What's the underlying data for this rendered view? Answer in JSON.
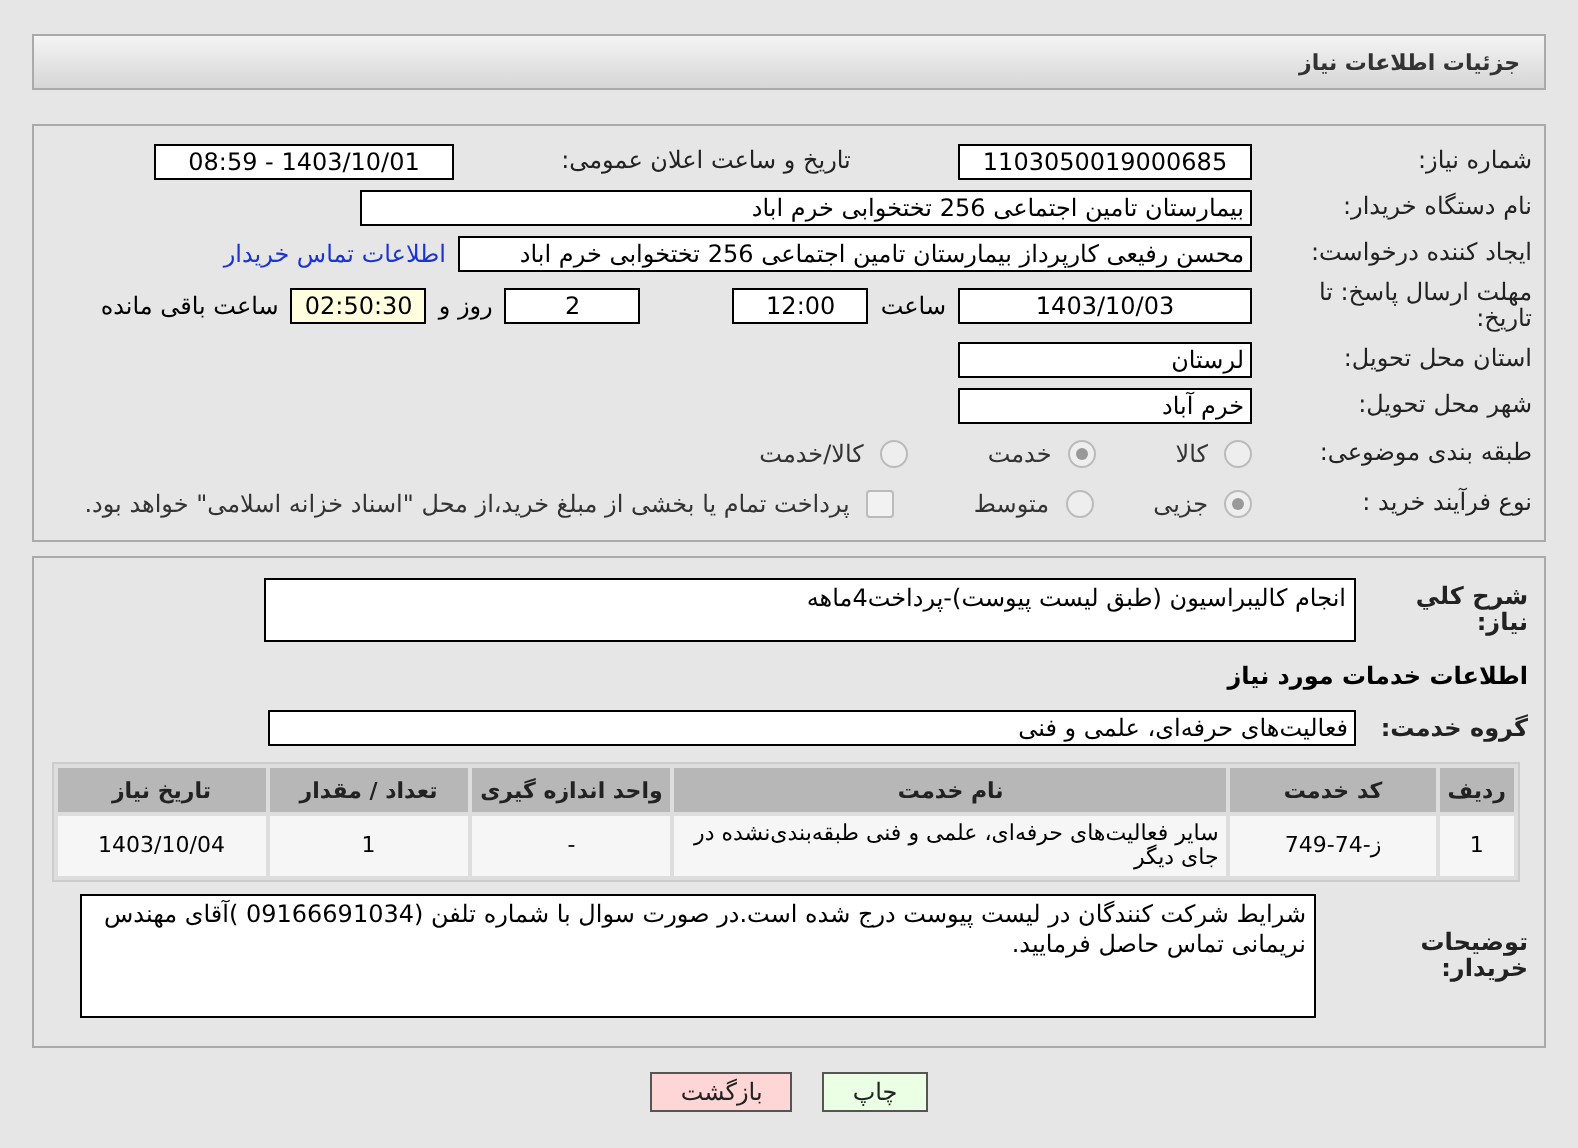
{
  "header": {
    "title": "جزئیات اطلاعات نیاز"
  },
  "need_number": {
    "label": "شماره نیاز:",
    "value": "1103050019000685"
  },
  "announce": {
    "label": "تاریخ و ساعت اعلان عمومی:",
    "value": "1403/10/01 - 08:59"
  },
  "buyer_org": {
    "label": "نام دستگاه خریدار:",
    "value": "بیمارستان تامین اجتماعی  256 تختخوابی خرم اباد"
  },
  "requester": {
    "label": "ایجاد کننده درخواست:",
    "value": "محسن رفیعی کارپرداز بیمارستان تامین اجتماعی  256 تختخوابی خرم اباد",
    "link": "اطلاعات تماس خریدار"
  },
  "deadline": {
    "label": "مهلت ارسال پاسخ: تا تاریخ:",
    "date": "1403/10/03",
    "time_label": "ساعت",
    "time": "12:00",
    "days": "2",
    "days_label": "روز و",
    "remaining": "02:50:30",
    "remaining_label": "ساعت باقی مانده"
  },
  "province": {
    "label": "استان محل تحویل:",
    "value": "لرستان"
  },
  "city": {
    "label": "شهر محل تحویل:",
    "value": "خرم آباد"
  },
  "category": {
    "label": "طبقه بندی موضوعی:",
    "options": [
      {
        "label": "کالا",
        "selected": false
      },
      {
        "label": "خدمت",
        "selected": true
      },
      {
        "label": "کالا/خدمت",
        "selected": false
      }
    ]
  },
  "process": {
    "label": "نوع فرآیند خرید :",
    "options": [
      {
        "label": "جزیی",
        "selected": true
      },
      {
        "label": "متوسط",
        "selected": false
      }
    ],
    "payment": {
      "label": "پرداخت تمام یا بخشی از مبلغ خرید،از محل \"اسناد خزانه اسلامی\" خواهد بود.",
      "checked": false
    }
  },
  "description": {
    "label": "شرح کلي نياز:",
    "value": "انجام کالیبراسیون (طبق لیست پیوست)-پرداخت4ماهه"
  },
  "services_title": "اطلاعات خدمات مورد نیاز",
  "service_group": {
    "label": "گروه خدمت:",
    "value": "فعالیت‌های حرفه‌ای، علمی و فنی"
  },
  "table": {
    "columns": [
      "ردیف",
      "کد خدمت",
      "نام خدمت",
      "واحد اندازه گیری",
      "تعداد / مقدار",
      "تاریخ نیاز"
    ],
    "rows": [
      [
        "1",
        "ز-74-749",
        "سایر فعالیت‌های حرفه‌ای، علمی و فنی طبقه‌بندی‌نشده در جای دیگر",
        "-",
        "1",
        "1403/10/04"
      ]
    ]
  },
  "buyer_notes": {
    "label": "توضیحات خریدار:",
    "value": "شرایط شرکت کنندگان در لیست پیوست درج شده است.در صورت سوال با شماره تلفن (09166691034 )آقای مهندس نریمانی تماس حاصل فرمایید."
  },
  "buttons": [
    {
      "label": "چاپ",
      "kind": "print"
    },
    {
      "label": "بازگشت",
      "kind": "back"
    }
  ]
}
